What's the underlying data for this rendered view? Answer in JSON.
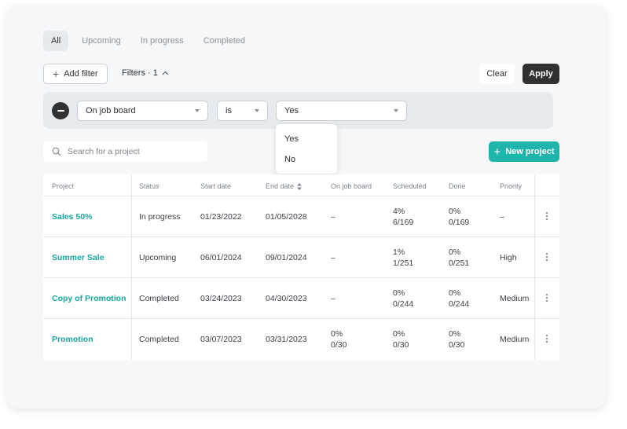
{
  "tabs": [
    "All",
    "Upcoming",
    "In progress",
    "Completed"
  ],
  "toolbar": {
    "add_filter": "Add filter",
    "filters_label": "Filters · 1",
    "clear": "Clear",
    "apply": "Apply"
  },
  "filter": {
    "field": "On job board",
    "operator": "is",
    "value": "Yes",
    "options": [
      "Yes",
      "No"
    ]
  },
  "search": {
    "placeholder": "Search for a project"
  },
  "new_project": "New project",
  "table": {
    "columns": [
      "Project",
      "Status",
      "Start date",
      "End date",
      "On job board",
      "Scheduled",
      "Done",
      "Priority"
    ],
    "rows": [
      {
        "project": "Sales 50%",
        "status": "In progress",
        "start": "01/23/2022",
        "end": "01/05/2028",
        "job_board": "–",
        "job_board_sub": "",
        "scheduled": "4%",
        "scheduled_sub": "6/169",
        "done": "0%",
        "done_sub": "0/169",
        "priority": "–"
      },
      {
        "project": "Summer Sale",
        "status": "Upcoming",
        "start": "06/01/2024",
        "end": "09/01/2024",
        "job_board": "–",
        "job_board_sub": "",
        "scheduled": "1%",
        "scheduled_sub": "1/251",
        "done": "0%",
        "done_sub": "0/251",
        "priority": "High"
      },
      {
        "project": "Copy of Promotion",
        "status": "Completed",
        "start": "03/24/2023",
        "end": "04/30/2023",
        "job_board": "–",
        "job_board_sub": "",
        "scheduled": "0%",
        "scheduled_sub": "0/244",
        "done": "0%",
        "done_sub": "0/244",
        "priority": "Medium"
      },
      {
        "project": "Promotion",
        "status": "Completed",
        "start": "03/07/2023",
        "end": "03/31/2023",
        "job_board": "0%",
        "job_board_sub": "0/30",
        "scheduled": "0%",
        "scheduled_sub": "0/30",
        "done": "0%",
        "done_sub": "0/30",
        "priority": "Medium"
      }
    ]
  },
  "colors": {
    "accent": "#1fb5ac",
    "dark_button": "#2f3133",
    "link": "#1aa59c"
  }
}
